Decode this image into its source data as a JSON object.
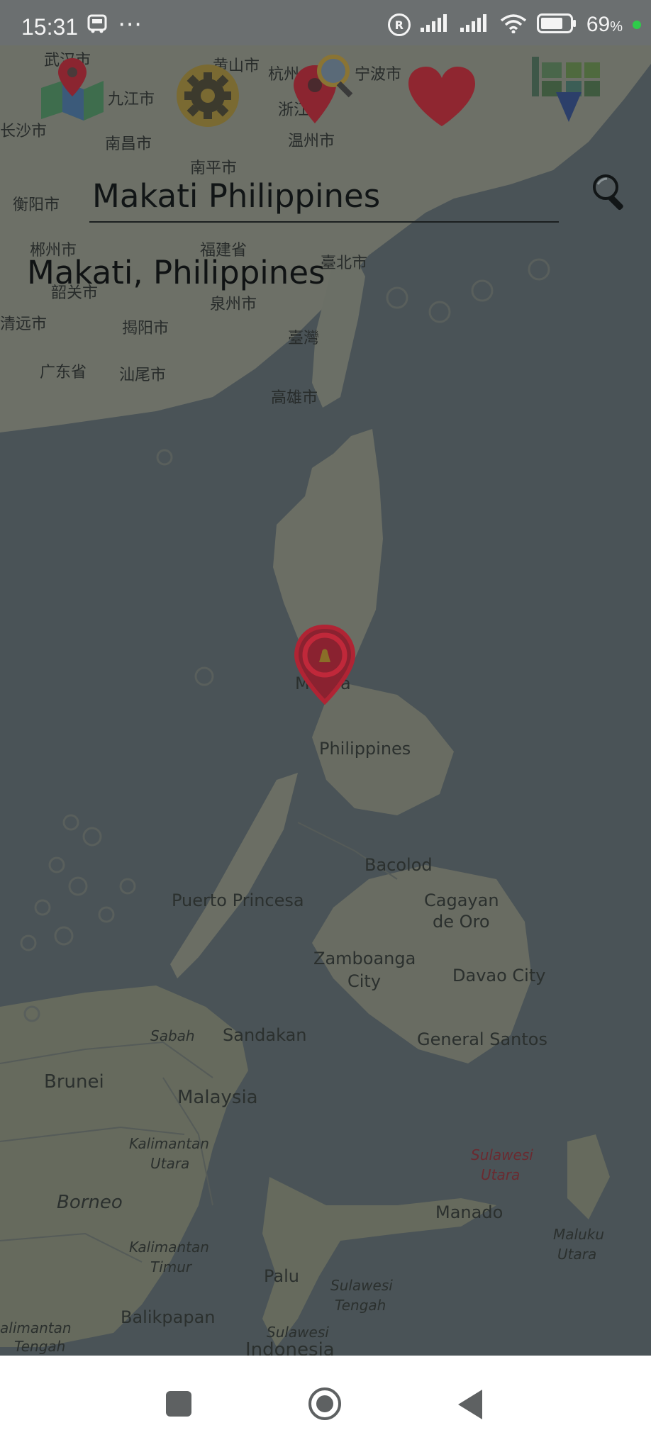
{
  "status_bar": {
    "time": "15:31",
    "extra": "⋯",
    "battery_percent": "69",
    "battery_unit": "%",
    "registered_mark": "R"
  },
  "search": {
    "value": "Makati Philippines"
  },
  "result": {
    "text": "Makati, Philippines"
  },
  "map_labels": {
    "wuhan": "武汉市",
    "jiujiang": "九江市",
    "hangzhou": "杭州",
    "ningbo": "宁波市",
    "huangshan": "黄山市",
    "changsha": "长沙市",
    "nanchang": "南昌市",
    "zhejiang": "浙江",
    "wenzhou": "温州市",
    "nanping": "南平市",
    "hengyang": "衡阳市",
    "chenzhou": "郴州市",
    "fujian": "福建省",
    "taipei": "臺北市",
    "shaoguan": "韶关市",
    "quanzhou": "泉州市",
    "qingyuan": "清远市",
    "jieyang": "揭阳市",
    "taiwan": "臺灣",
    "guangdong": "广东省",
    "shanwei": "汕尾市",
    "kaohsiung": "高雄市",
    "manila": "Manila",
    "philippines": "Philippines",
    "bacolod": "Bacolod",
    "puerto_princesa": "Puerto Princesa",
    "cagayan": "Cagayan",
    "de_oro": "de Oro",
    "zamboanga": "Zamboanga",
    "city": "City",
    "davao": "Davao City",
    "sabah": "Sabah",
    "sandakan": "Sandakan",
    "general_santos": "General Santos",
    "brunei": "Brunei",
    "malaysia": "Malaysia",
    "kalimantan_utara_1": "Kalimantan",
    "kalimantan_utara_2": "Utara",
    "sulawesi_utara_1": "Sulawesi",
    "sulawesi_utara_2": "Utara",
    "borneo": "Borneo",
    "manado": "Manado",
    "maluku_utara_1": "Maluku",
    "maluku_utara_2": "Utara",
    "kalimantan_timur_1": "Kalimantan",
    "kalimantan_timur_2": "Timur",
    "palu": "Palu",
    "sulawesi_tengah_1": "Sulawesi",
    "sulawesi_tengah_2": "Tengah",
    "balikpapan": "Balikpapan",
    "kalimantan_tengah_1": "alimantan",
    "kalimantan_tengah_2": "Tengah",
    "sulawesi_bottom": "Sulawesi",
    "indonesia": "Indonesia"
  },
  "toolbar": {
    "icons": [
      "map-pin-icon",
      "settings-gear-icon",
      "location-search-icon",
      "favorites-heart-icon",
      "map-grid-icon"
    ]
  },
  "nav": {
    "icons": [
      "recent-apps-square-icon",
      "home-circle-icon",
      "back-triangle-icon"
    ]
  },
  "colors": {
    "overlay": "#3a4144",
    "water": "#4b5559",
    "land": "#6c6f66",
    "marker": "#c0283a",
    "heart": "#b62430",
    "status_bar": "#6b6f70",
    "nav_bar": "#ffffff"
  }
}
